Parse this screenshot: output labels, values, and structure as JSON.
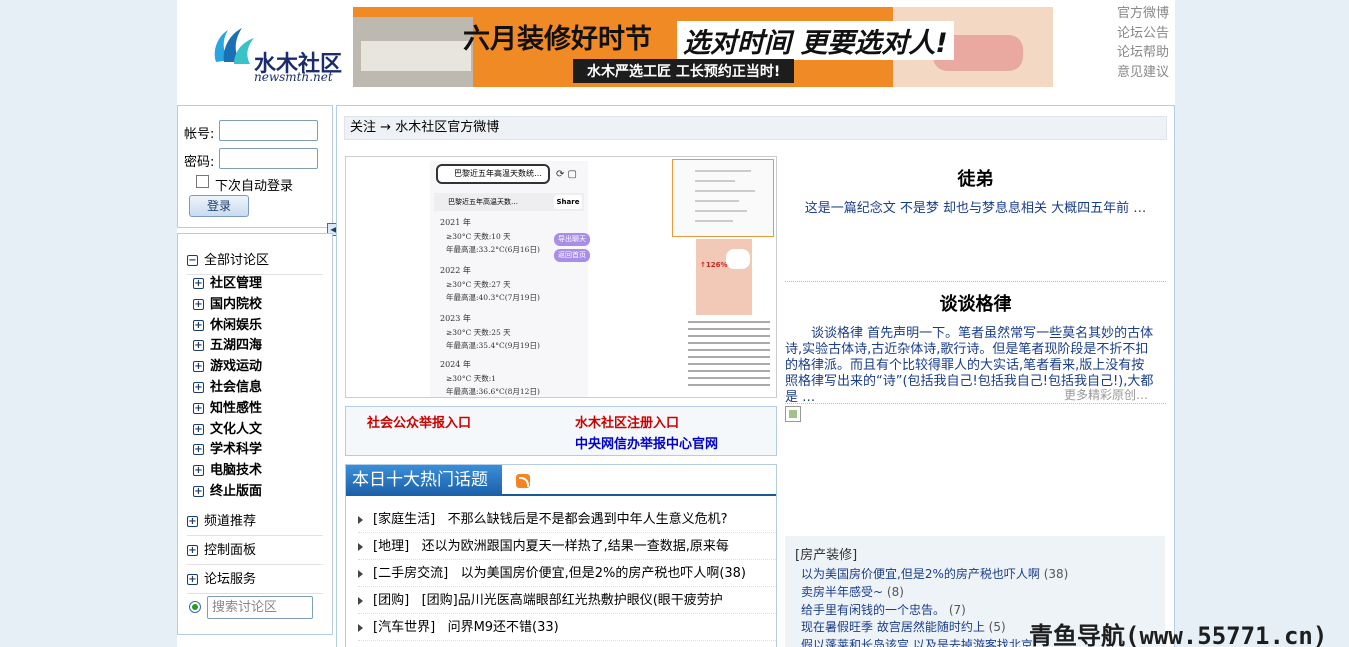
{
  "logo": {
    "name": "水木社区",
    "url": "newsmth.net"
  },
  "banner": {
    "line1": "六月装修好时节",
    "line2": "选对时间 更要选对人!",
    "line3": "水木严选工匠 工长预约正当时!"
  },
  "toplinks": [
    "官方微博",
    "论坛公告",
    "论坛帮助",
    "意见建议"
  ],
  "login": {
    "account_label": "帐号:",
    "password_label": "密码:",
    "remember_label": "下次自动登录",
    "login_button": "登录"
  },
  "nav": {
    "all_boards": "全部讨论区",
    "items": [
      "社区管理",
      "国内院校",
      "休闲娱乐",
      "五湖四海",
      "游戏运动",
      "社会信息",
      "知性感性",
      "文化人文",
      "学术科学",
      "电脑技术",
      "终止版面"
    ],
    "channel": "频道推荐",
    "control": "控制面板",
    "service": "论坛服务",
    "search_placeholder": "搜索讨论区"
  },
  "crumb": {
    "follow": "关注",
    "arrow": "→",
    "target": "水木社区官方微博"
  },
  "shot": {
    "query": "巴黎近五年高温天数统…",
    "tab": "巴黎近五年高温天数…",
    "share": "Share",
    "btn_export": "导出聊天",
    "btn_back": "返回首页",
    "years": [
      {
        "year": "2021 年",
        "days": "≥30°C 天数:10 天",
        "max": "年最高温:33.2°C(6月16日)"
      },
      {
        "year": "2022 年",
        "days": "≥30°C 天数:27 天",
        "max": "年最高温:40.3°C(7月19日)"
      },
      {
        "year": "2023 年",
        "days": "≥30°C 天数:25 天",
        "max": "年最高温:35.4°C(9月19日)"
      },
      {
        "year": "2024 年",
        "days": "≥30°C 天数:1",
        "max": "年最高温:36.6°C(8月12日)"
      }
    ],
    "ad_text": "↑126%"
  },
  "report": {
    "public": "社会公众举报入口",
    "register": "水木社区注册入口",
    "cac": "中央网信办举报中心官网"
  },
  "hot": {
    "title": "本日十大热门话题",
    "topics": [
      {
        "board": "[家庭生活]",
        "title": "不那么缺钱后是不是都会遇到中年人生意义危机?"
      },
      {
        "board": "[地理]",
        "title": "还以为欧洲跟国内夏天一样热了,结果一查数据,原来每"
      },
      {
        "board": "[二手房交流]",
        "title": "以为美国房价便宜,但是2%的房产税也吓人啊(38)"
      },
      {
        "board": "[团购]",
        "title": "[团购]品川光医高端眼部红光热敷护眼仪(眼干疲劳护"
      },
      {
        "board": "[汽车世界]",
        "title": "问界M9还不错(33)"
      }
    ]
  },
  "articles": [
    {
      "title": "徒弟",
      "summary": "这是一篇纪念文 不是梦 却也与梦息息相关 大概四五年前 …"
    },
    {
      "title": "谈谈格律",
      "summary": "谈谈格律 首先声明一下。笔者虽然常写一些莫名其妙的古体诗,实验古体诗,古近杂体诗,歌行诗。但是笔者现阶段是不折不扣的格律派。而且有个比较得罪人的大实话,笔者看来,版上没有按照格律写出来的“诗”(包括我自己!包括我自己!包括我自己!),大都是 …"
    }
  ],
  "more_label": "更多精彩原创…",
  "board_block": {
    "title": "[房产装修]",
    "items": [
      {
        "t": "以为美国房价便宜,但是2%的房产税也吓人啊",
        "n": "(38)"
      },
      {
        "t": "卖房半年感受~",
        "n": "(8)"
      },
      {
        "t": "给手里有闲钱的一个忠告。",
        "n": "(7)"
      },
      {
        "t": "现在暑假旺季 故宫居然能随时约上",
        "n": "(5)"
      },
      {
        "t": "假以蓬莱和长岛该宫,以及是去掉游客找北京",
        "n": ""
      }
    ]
  },
  "watermark": "青鱼导航(www.55771.cn)",
  "colors": {
    "accent": "#1a5fa8",
    "report_red": "#cc0000",
    "report_blue": "#0000cc",
    "banner_orange": "#f08a24"
  }
}
